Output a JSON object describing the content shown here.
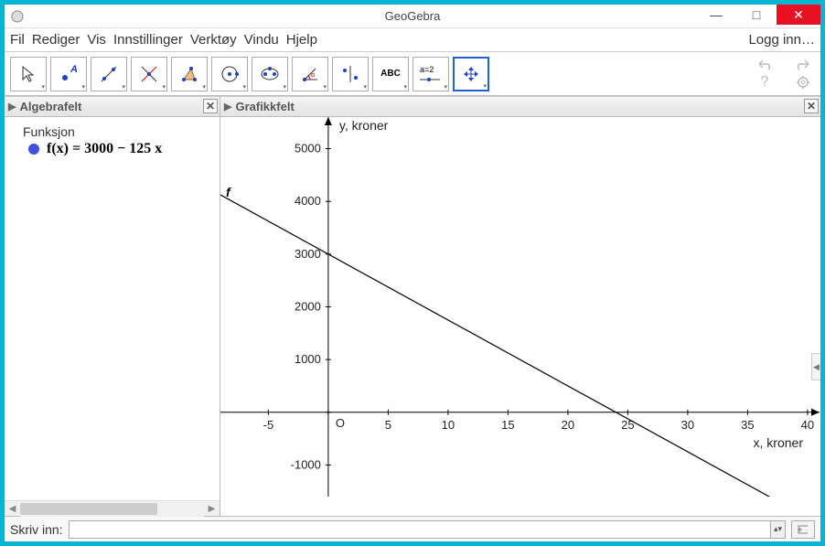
{
  "window": {
    "title": "GeoGebra"
  },
  "menu": {
    "items": [
      "Fil",
      "Rediger",
      "Vis",
      "Innstillinger",
      "Verktøy",
      "Vindu",
      "Hjelp"
    ],
    "login": "Logg inn…"
  },
  "toolbar": {
    "tools": [
      {
        "name": "move-tool",
        "icon": "cursor"
      },
      {
        "name": "point-tool",
        "icon": "point-a"
      },
      {
        "name": "line-tool",
        "icon": "line"
      },
      {
        "name": "perpendicular-tool",
        "icon": "perp"
      },
      {
        "name": "polygon-tool",
        "icon": "polygon"
      },
      {
        "name": "circle-tool",
        "icon": "circle"
      },
      {
        "name": "ellipse-tool",
        "icon": "ellipse"
      },
      {
        "name": "angle-tool",
        "icon": "angle"
      },
      {
        "name": "reflect-tool",
        "icon": "reflect"
      },
      {
        "name": "text-tool",
        "icon": "abc",
        "label": "ABC"
      },
      {
        "name": "slider-tool",
        "icon": "slider",
        "label": "a=2"
      },
      {
        "name": "move-view-tool",
        "icon": "move-view",
        "selected": true
      }
    ]
  },
  "panels": {
    "algebra_title": "Algebrafelt",
    "graphics_title": "Grafikkfelt"
  },
  "algebra": {
    "category": "Funksjon",
    "formula": "f(x)  =  3000 − 125 x"
  },
  "chart_data": {
    "type": "line",
    "function": "f(x) = 3000 - 125x",
    "slope": -125,
    "intercept": 3000,
    "xlabel": "x, kroner",
    "ylabel": "y, kroner",
    "x_ticks": [
      -5,
      0,
      5,
      10,
      15,
      20,
      25,
      30,
      35,
      40
    ],
    "y_ticks": [
      -1000,
      0,
      1000,
      2000,
      3000,
      4000,
      5000
    ],
    "xlim": [
      -9,
      41
    ],
    "ylim": [
      -1600,
      5600
    ],
    "origin_label": "O"
  },
  "inputbar": {
    "label": "Skriv inn:",
    "value": ""
  }
}
